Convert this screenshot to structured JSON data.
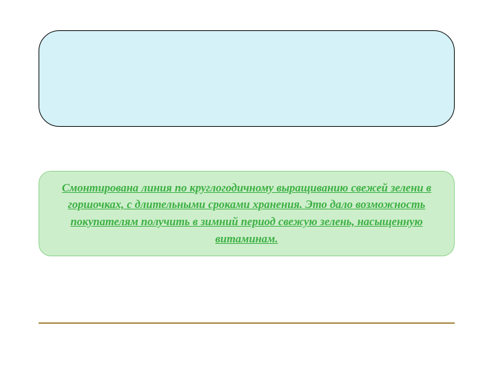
{
  "bottom_box": {
    "text": "Смонтирована линия по круглогодичному выращиванию свежей зелени в горшочках, с длительными сроками хранения. Это дало возможность покупателям получить в зимний период свежую зелень, насыщенную витаминам."
  }
}
